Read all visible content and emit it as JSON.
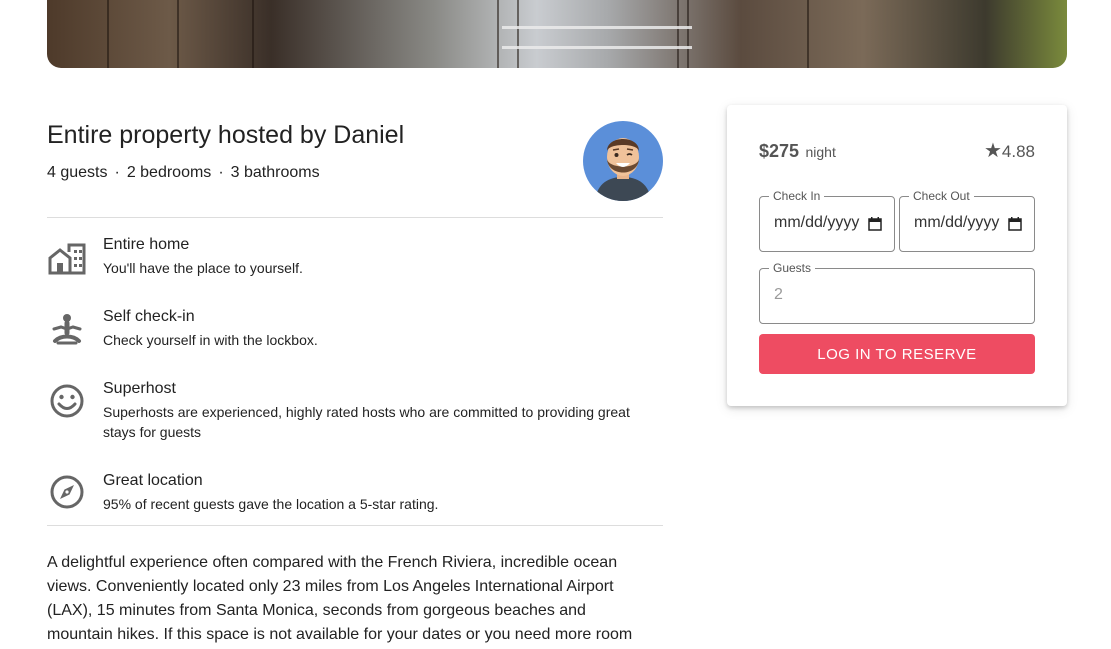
{
  "listing": {
    "title": "Entire property hosted by Daniel",
    "specs": [
      "4 guests",
      "2 bedrooms",
      "3 bathrooms"
    ],
    "spec_separator": "·",
    "host_avatar": "host-avatar-daniel"
  },
  "features": [
    {
      "icon": "home-icon",
      "title": "Entire home",
      "subtitle": "You'll have the place to yourself."
    },
    {
      "icon": "meditation-icon",
      "title": "Self check-in",
      "subtitle": "Check yourself in with the lockbox."
    },
    {
      "icon": "smiley-icon",
      "title": "Superhost",
      "subtitle": "Superhosts are experienced, highly rated hosts who are committed to providing great stays for guests"
    },
    {
      "icon": "compass-icon",
      "title": "Great location",
      "subtitle": "95% of recent guests gave the location a 5-star rating."
    }
  ],
  "description": "A delightful experience often compared with the French Riviera, incredible ocean views. Conveniently located only 23 miles from Los Angeles International Airport (LAX), 15 minutes from Santa Monica, seconds from gorgeous beaches and mountain hikes. If this space is not available for your dates or you need more room",
  "booking": {
    "price": "$275",
    "per": "night",
    "rating": "4.88",
    "star_icon": "star-icon",
    "check_in_label": "Check In",
    "check_in_value": "mm/dd/yyyy",
    "check_out_label": "Check Out",
    "check_out_value": "mm/dd/yyyy",
    "guests_label": "Guests",
    "guests_placeholder": "2",
    "reserve_label": "LOG IN TO RESERVE"
  },
  "colors": {
    "accent": "#ee4c62",
    "avatar_bg": "#5b8fd9",
    "icon": "#666666"
  }
}
